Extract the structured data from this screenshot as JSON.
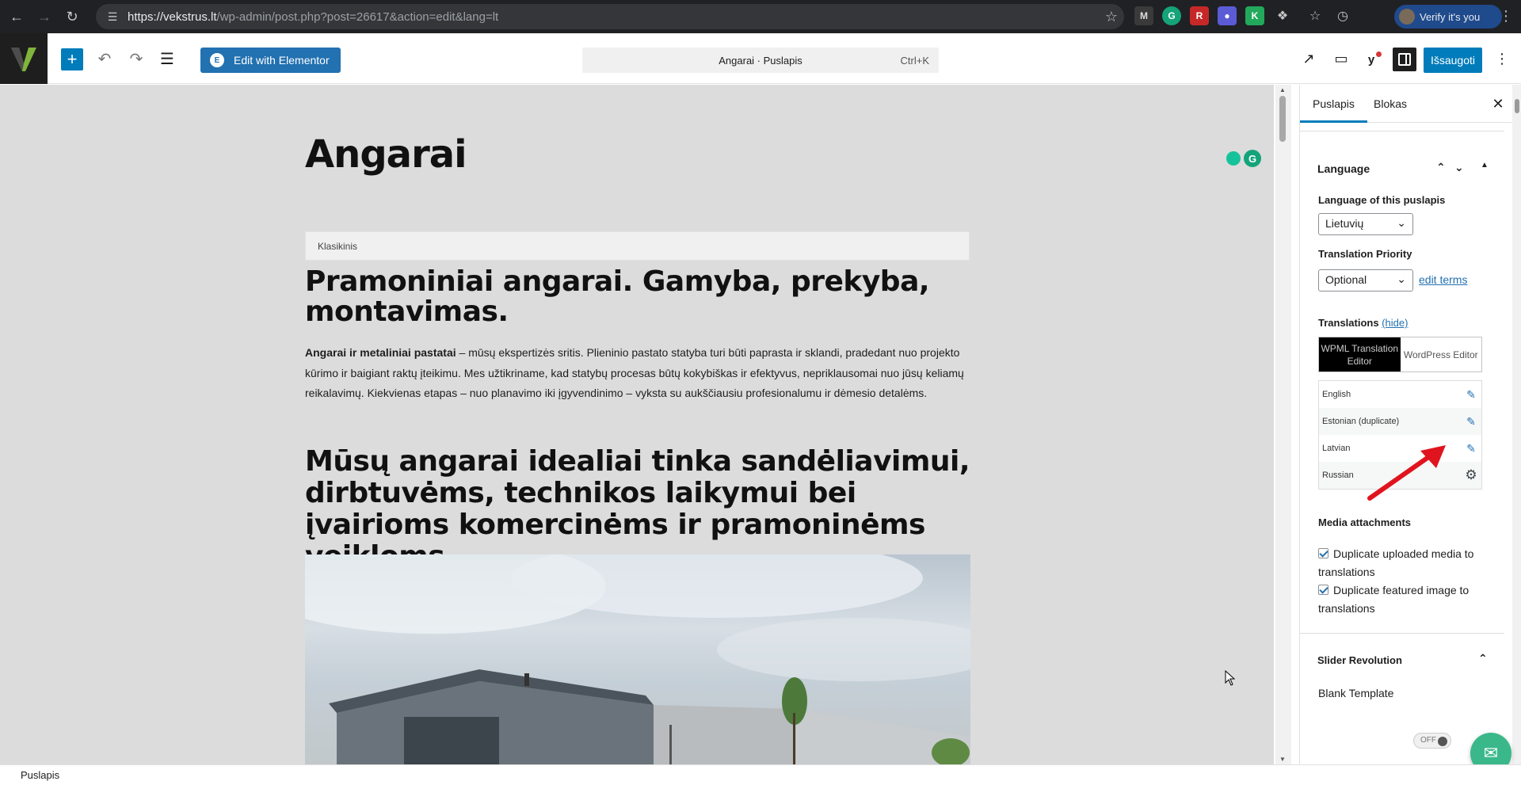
{
  "browser": {
    "url_host": "https://vekstrus.lt",
    "url_rest": "/wp-admin/post.php?post=26617&action=edit&lang=lt",
    "profile_label": "Verify it's you"
  },
  "toolbar": {
    "edit_with_elementor": "Edit with Elementor",
    "command_title": "Angarai · Puslapis",
    "command_shortcut": "Ctrl+K",
    "save_label": "Išsaugoti"
  },
  "content": {
    "title": "Angarai",
    "classic_block_label": "Klasikinis",
    "heading_1": "Pramoniniai angarai. Gamyba, prekyba, montavimas.",
    "paragraph_bold": "Angarai ir metaliniai pastatai",
    "paragraph_rest": " – mūsų ekspertizės sritis. Plieninio pastato statyba turi būti paprasta ir sklandi, pradedant nuo projekto kūrimo ir baigiant raktų įteikimu. Mes užtikriname, kad statybų procesas būtų kokybiškas ir efektyvus, nepriklausomai nuo jūsų keliamų reikalavimų. Kiekvienas etapas – nuo planavimo iki įgyvendinimo – vyksta su aukščiausiu profesionalumu ir dėmesio detalėms.",
    "heading_2": "Mūsų angarai idealiai tinka sandėliavimui, dirbtuvėms, technikos laikymui bei įvairioms komercinėms ir pramoninėms veikloms."
  },
  "status_bar": {
    "text": "Puslapis"
  },
  "sidebar": {
    "tab_page": "Puslapis",
    "tab_block": "Blokas",
    "language_panel_title": "Language",
    "language_of_page_label": "Language of this puslapis",
    "language_value": "Lietuvių",
    "translation_priority_label": "Translation Priority",
    "priority_value": "Optional",
    "edit_terms_link": "edit terms",
    "translations_label": "Translations",
    "hide_link": "(hide)",
    "editor_option_wpml": "WPML Translation Editor",
    "editor_option_wp": "WordPress Editor",
    "translations": [
      {
        "language": "English",
        "action": "pencil-icon"
      },
      {
        "language": "Estonian (duplicate)",
        "action": "pencil-icon"
      },
      {
        "language": "Latvian",
        "action": "pencil-icon"
      },
      {
        "language": "Russian",
        "action": "gear-icon"
      }
    ],
    "media_title": "Media attachments",
    "dup_media_label": "Duplicate uploaded media to translations",
    "dup_featured_label": "Duplicate featured image to translations",
    "slider_panel_title": "Slider Revolution",
    "blank_template_label": "Blank Template",
    "blank_template_toggle": "OFF"
  },
  "colors": {
    "wp_blue": "#007cba",
    "elementor_blue": "#2271b1",
    "annotation_red": "#e0141e"
  }
}
